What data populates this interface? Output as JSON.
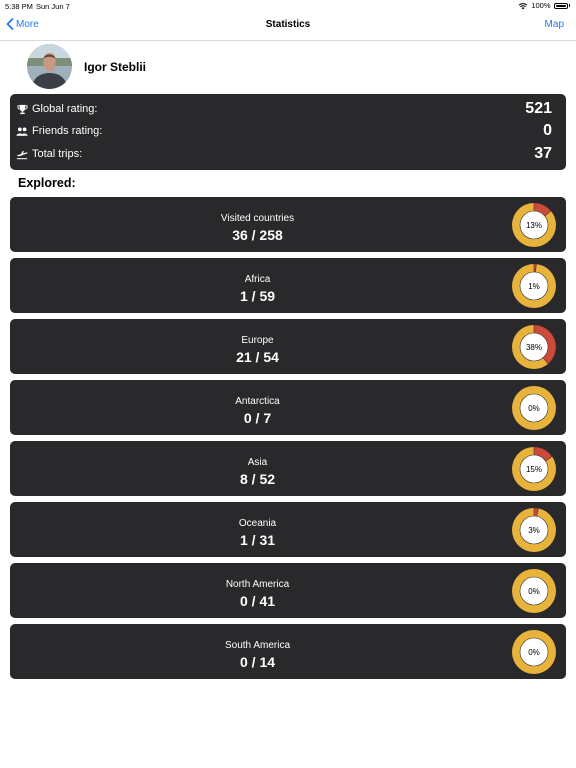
{
  "status_bar": {
    "time": "5:38 PM",
    "date": "Sun Jun 7",
    "battery": "100%"
  },
  "nav": {
    "back_label": "More",
    "title": "Statistics",
    "right_label": "Map"
  },
  "profile": {
    "name": "Igor Steblii"
  },
  "ratings": {
    "global": {
      "label": "Global rating:",
      "value": "521",
      "icon": "trophy-icon"
    },
    "friends": {
      "label": "Friends rating:",
      "value": "0",
      "icon": "people-icon"
    },
    "trips": {
      "label": "Total trips:",
      "value": "37",
      "icon": "plane-departure-icon"
    }
  },
  "explored_title": "Explored:",
  "colors": {
    "ring": "#e8b33b",
    "visited": "#cc4a3a",
    "card": "#29282b",
    "accent": "#1a7cf5"
  },
  "regions": [
    {
      "name": "Visited countries",
      "count": "36 / 258",
      "percent_label": "13%",
      "fraction": 0.14
    },
    {
      "name": "Africa",
      "count": "1 / 59",
      "percent_label": "1%",
      "fraction": 0.017
    },
    {
      "name": "Europe",
      "count": "21 / 54",
      "percent_label": "38%",
      "fraction": 0.389
    },
    {
      "name": "Antarctica",
      "count": "0 / 7",
      "percent_label": "0%",
      "fraction": 0
    },
    {
      "name": "Asia",
      "count": "8 / 52",
      "percent_label": "15%",
      "fraction": 0.154
    },
    {
      "name": "Oceania",
      "count": "1 / 31",
      "percent_label": "3%",
      "fraction": 0.032
    },
    {
      "name": "North America",
      "count": "0 / 41",
      "percent_label": "0%",
      "fraction": 0
    },
    {
      "name": "South America",
      "count": "0 / 14",
      "percent_label": "0%",
      "fraction": 0
    }
  ]
}
